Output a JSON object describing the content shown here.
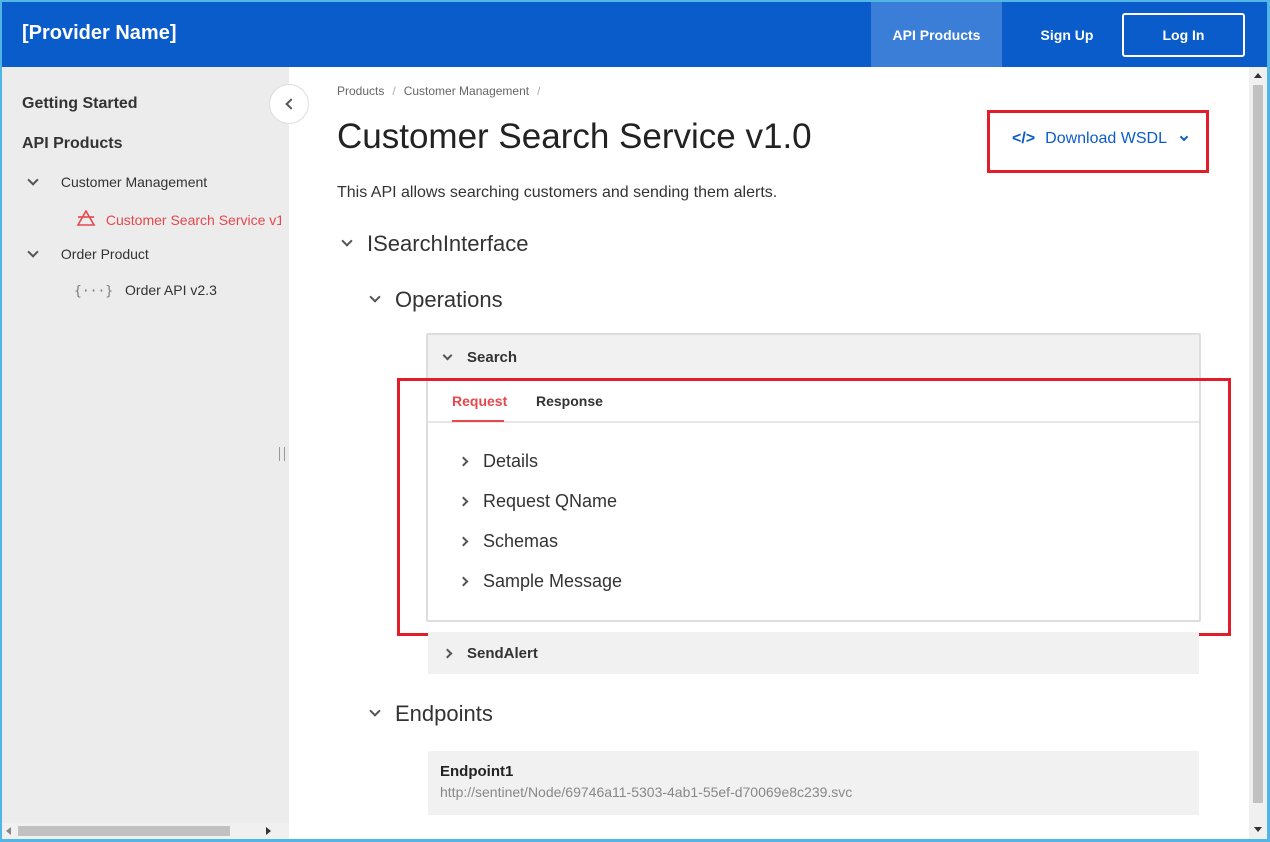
{
  "header": {
    "brand": "[Provider Name]",
    "nav": {
      "api_products": "API Products",
      "sign_up": "Sign Up",
      "log_in": "Log In"
    }
  },
  "sidebar": {
    "getting_started": "Getting Started",
    "api_products": "API Products",
    "items": [
      {
        "label": "Customer Management",
        "icon": "chevron-down-icon"
      },
      {
        "label": "Customer Search Service v1",
        "icon": "soap-triangle-icon",
        "active": true
      },
      {
        "label": "Order Product",
        "icon": "chevron-down-icon"
      },
      {
        "label": "Order API v2.3",
        "icon": "rest-braces-icon"
      }
    ]
  },
  "breadcrumb": [
    "Products",
    "Customer Management"
  ],
  "page": {
    "title": "Customer Search Service v1.0",
    "download_label": "Download WSDL",
    "description": "This API allows searching customers and sending them alerts."
  },
  "interface": {
    "name": "ISearchInterface",
    "operations_label": "Operations",
    "operations": [
      {
        "name": "Search",
        "tabs": [
          "Request",
          "Response"
        ],
        "active_tab": "Request",
        "sections": [
          "Details",
          "Request QName",
          "Schemas",
          "Sample Message"
        ]
      },
      {
        "name": "SendAlert"
      }
    ],
    "endpoints_label": "Endpoints",
    "endpoints": [
      {
        "name": "Endpoint1",
        "url": "http://sentinet/Node/69746a11-5303-4ab1-55ef-d70069e8c239.svc"
      }
    ]
  },
  "colors": {
    "header_bg": "#0b5ccb",
    "active_nav_bg": "#3b7ed8",
    "accent_red": "#e5484d",
    "highlight_box": "#e11d2a",
    "link_blue": "#0b5ccb"
  }
}
